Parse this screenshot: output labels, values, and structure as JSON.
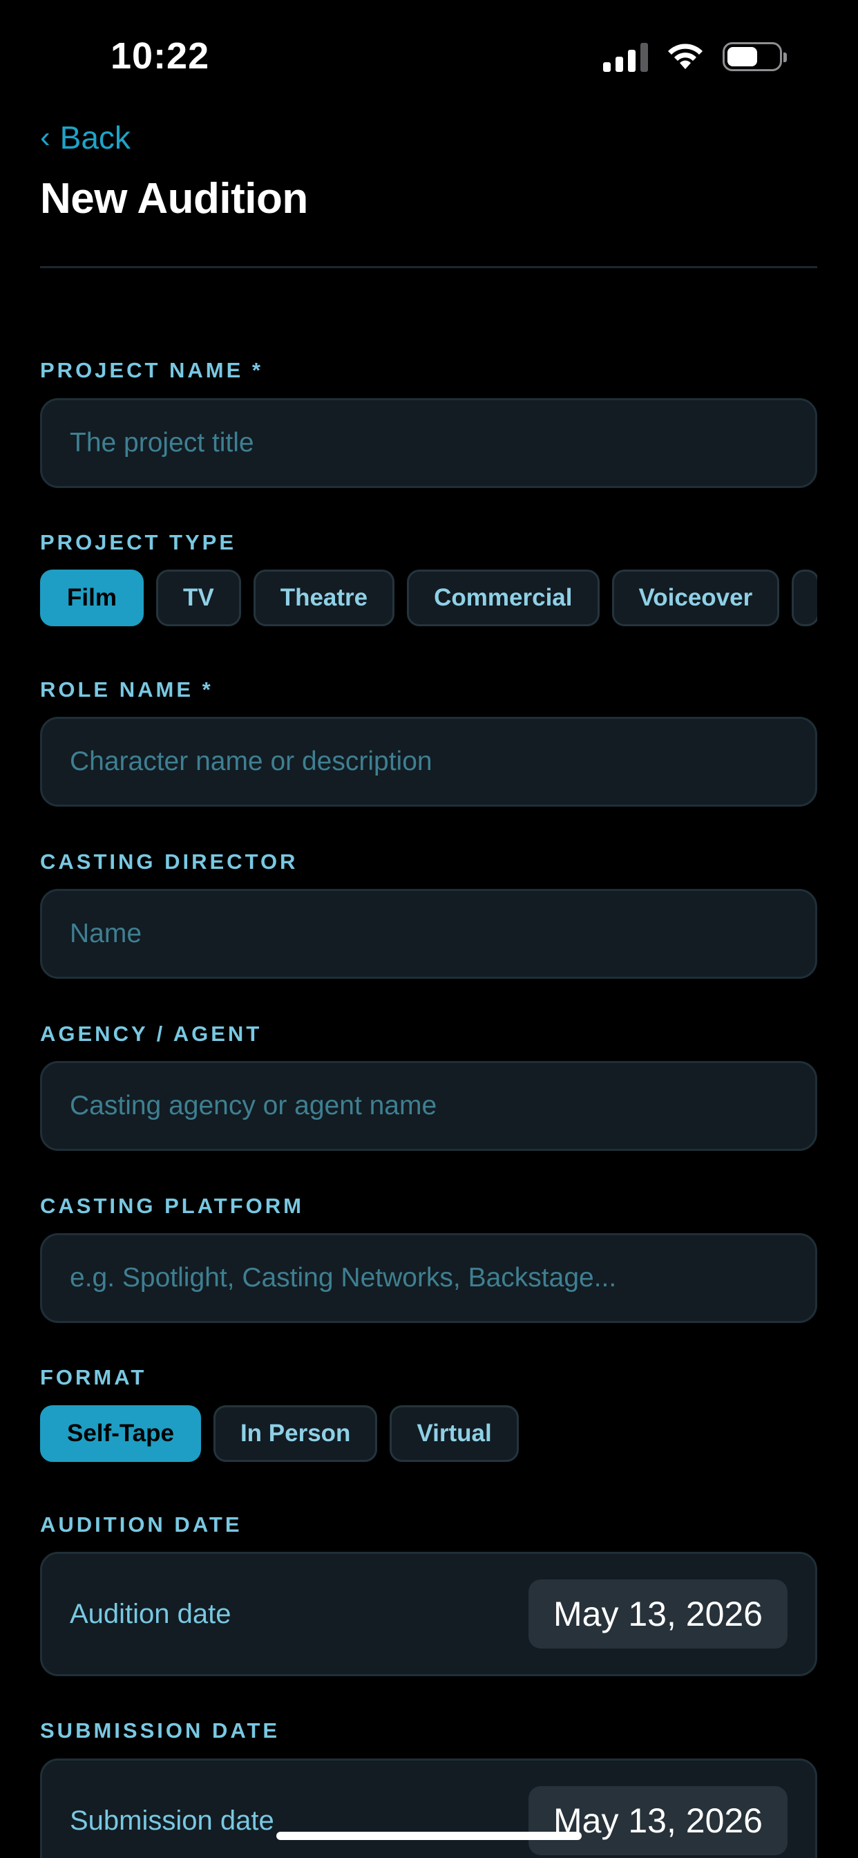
{
  "status_bar": {
    "time": "10:22",
    "icons": [
      "cellular-signal-icon",
      "wifi-icon",
      "battery-icon"
    ],
    "battery_level": 0.6
  },
  "header": {
    "back_label": "Back",
    "title": "New Audition"
  },
  "form": {
    "project_name": {
      "label": "PROJECT NAME *",
      "placeholder": "The project title",
      "value": ""
    },
    "project_type": {
      "label": "PROJECT TYPE",
      "options": [
        "Film",
        "TV",
        "Theatre",
        "Commercial",
        "Voiceover"
      ],
      "selected": "Film"
    },
    "role_name": {
      "label": "ROLE NAME *",
      "placeholder": "Character name or description",
      "value": ""
    },
    "casting_director": {
      "label": "CASTING DIRECTOR",
      "placeholder": "Name",
      "value": ""
    },
    "agency": {
      "label": "AGENCY / AGENT",
      "placeholder": "Casting agency or agent name",
      "value": ""
    },
    "casting_platform": {
      "label": "CASTING PLATFORM",
      "placeholder": "e.g. Spotlight, Casting Networks, Backstage...",
      "value": ""
    },
    "format": {
      "label": "FORMAT",
      "options": [
        "Self-Tape",
        "In Person",
        "Virtual"
      ],
      "selected": "Self-Tape"
    },
    "audition_date": {
      "label": "AUDITION DATE",
      "field_label": "Audition date",
      "value": "May 13, 2026"
    },
    "submission_date": {
      "label": "SUBMISSION DATE",
      "field_label": "Submission date",
      "value": "May 13, 2026"
    }
  },
  "colors": {
    "accent": "#1e9ec4",
    "label": "#79c8e2",
    "input_bg": "#121c22",
    "background": "#000000"
  }
}
